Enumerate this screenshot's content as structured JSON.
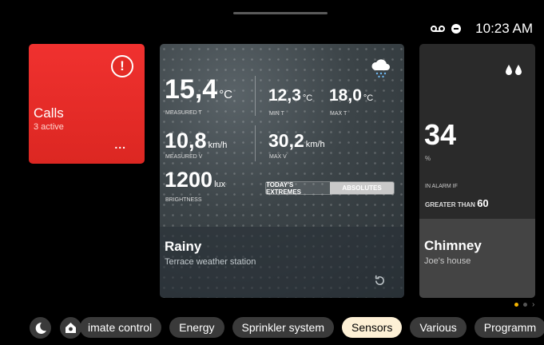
{
  "status": {
    "time": "10:23 AM",
    "icons": [
      "voicemail-icon",
      "do-not-disturb-icon"
    ]
  },
  "calls": {
    "title": "Calls",
    "subtitle": "3 active",
    "more": "...",
    "alert_icon": "exclamation-icon",
    "alert_symbol": "!"
  },
  "weather": {
    "measured_t": {
      "value": "15,4",
      "unit": "°C",
      "label": "MEASURED T"
    },
    "min_t": {
      "value": "12,3",
      "unit": "°C",
      "label": "MIN T"
    },
    "max_t": {
      "value": "18,0",
      "unit": "°C",
      "label": "MAX T"
    },
    "measured_v": {
      "value": "10,8",
      "unit": "km/h",
      "label": "MEASURED V"
    },
    "max_v": {
      "value": "30,2",
      "unit": "km/h",
      "label": "MAX V"
    },
    "brightness": {
      "value": "1200",
      "unit": "lux",
      "label": "BRIGHTNESS"
    },
    "toggle": {
      "left": "TODAY'S EXTREMES",
      "right": "ABSOLUTES",
      "selected": "ABSOLUTES"
    },
    "title": "Rainy",
    "subtitle": "Terrace weather station",
    "icon": "rain-cloud-icon"
  },
  "chimney": {
    "value": "34",
    "unit": "%",
    "alarm_label": "IN ALARM IF",
    "condition": "GREATER THAN",
    "threshold": "60",
    "title": "Chimney",
    "subtitle": "Joe's house",
    "icon": "humidity-drops-icon"
  },
  "pager": {
    "pages": 2,
    "current": 1
  },
  "tabs": [
    "imate control",
    "Energy",
    "Sprinkler system",
    "Sensors",
    "Various",
    "Programm"
  ],
  "active_tab": "Sensors",
  "colors": {
    "calls_red": "#e8302b",
    "active_tab_bg": "#fdf0d5",
    "pager_active": "#f5b400"
  }
}
